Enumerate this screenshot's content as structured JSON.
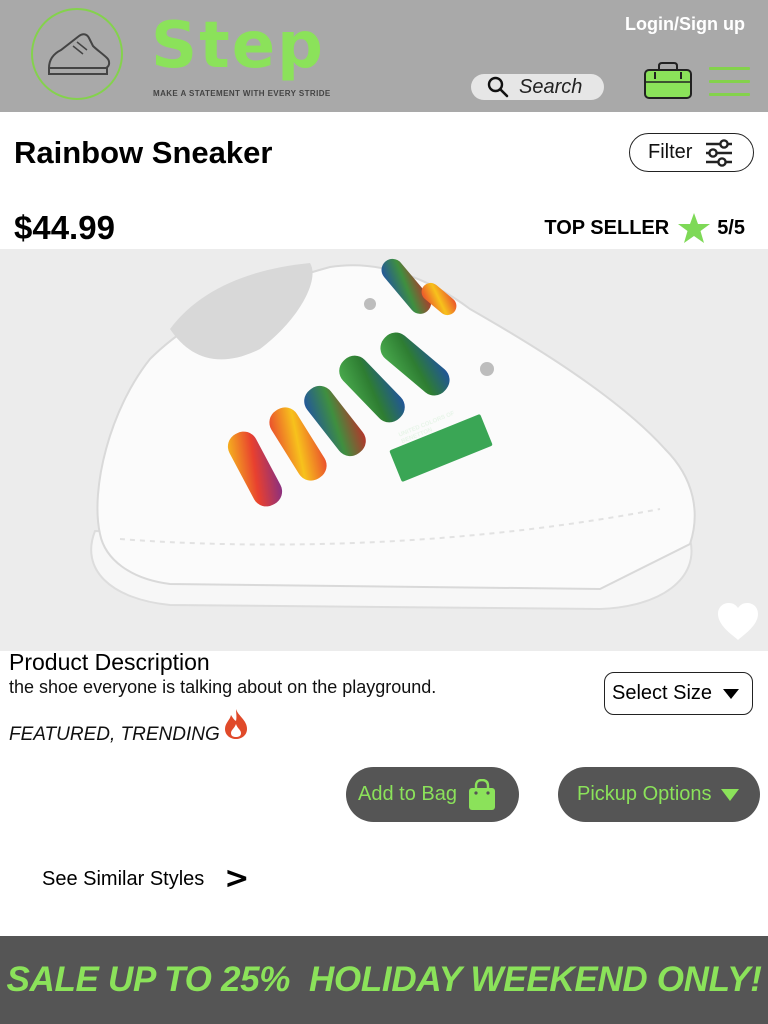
{
  "header": {
    "brand_name": "Step",
    "tagline": "MAKE A STATEMENT WITH EVERY STRIDE",
    "login_label": "Login/Sign up",
    "search_placeholder": "Search",
    "logo_icon": "sneaker-outline-icon",
    "bag_icon": "shopping-bag-icon",
    "menu_icon": "hamburger-menu-icon",
    "brand_color": "#8be25a",
    "header_bg": "#a9a9a9"
  },
  "product": {
    "title": "Rainbow Sneaker",
    "price": "$44.99",
    "badge": "TOP SELLER",
    "rating": "5/5",
    "image_label": "UNITED COLORS OF BENETTON",
    "description_heading": "Product Description",
    "description": "the shoe everyone is talking about on the playground.",
    "tags": "FEATURED, TRENDING"
  },
  "filter": {
    "label": "Filter"
  },
  "actions": {
    "size_select_label": "Select Size",
    "add_to_bag_label": "Add to Bag",
    "pickup_label": "Pickup Options",
    "similar_label": "See Similar Styles",
    "similar_chevron": ">"
  },
  "banner": {
    "text": "SALE UP TO 25%  HOLIDAY WEEKEND ONLY!"
  },
  "colors": {
    "accent": "#8be25a",
    "button_bg": "#555555",
    "flame": "#e04a2a",
    "star": "#7ed957"
  }
}
